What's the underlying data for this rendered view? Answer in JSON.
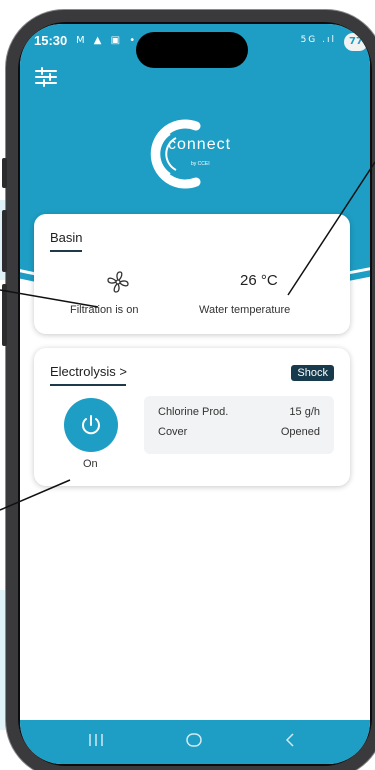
{
  "status_bar": {
    "time": "15:30",
    "left_icons": "M ▲ ▣ •",
    "right_icons": "5G .ıl",
    "battery": "77"
  },
  "header": {
    "logo_text": "connect",
    "logo_sub": "by CCEI",
    "filter_icon": "sliders-icon"
  },
  "basin": {
    "title": "Basin",
    "filtration_label": "Filtration is on",
    "temperature_value": "26 °C",
    "temperature_label": "Water temperature",
    "fan_icon": "fan-icon"
  },
  "electrolysis": {
    "title": "Electrolysis >",
    "badge": "Shock",
    "power_state": "On",
    "rows": [
      {
        "label": "Chlorine Prod.",
        "value": "15 g/h"
      },
      {
        "label": "Cover",
        "value": "Opened"
      }
    ]
  },
  "nav": {
    "items": [
      "recent-apps-icon",
      "home-icon",
      "back-icon"
    ]
  },
  "colors": {
    "accent": "#1e9ec4",
    "badge": "#173b4d",
    "frame": "#3a3a3c"
  }
}
